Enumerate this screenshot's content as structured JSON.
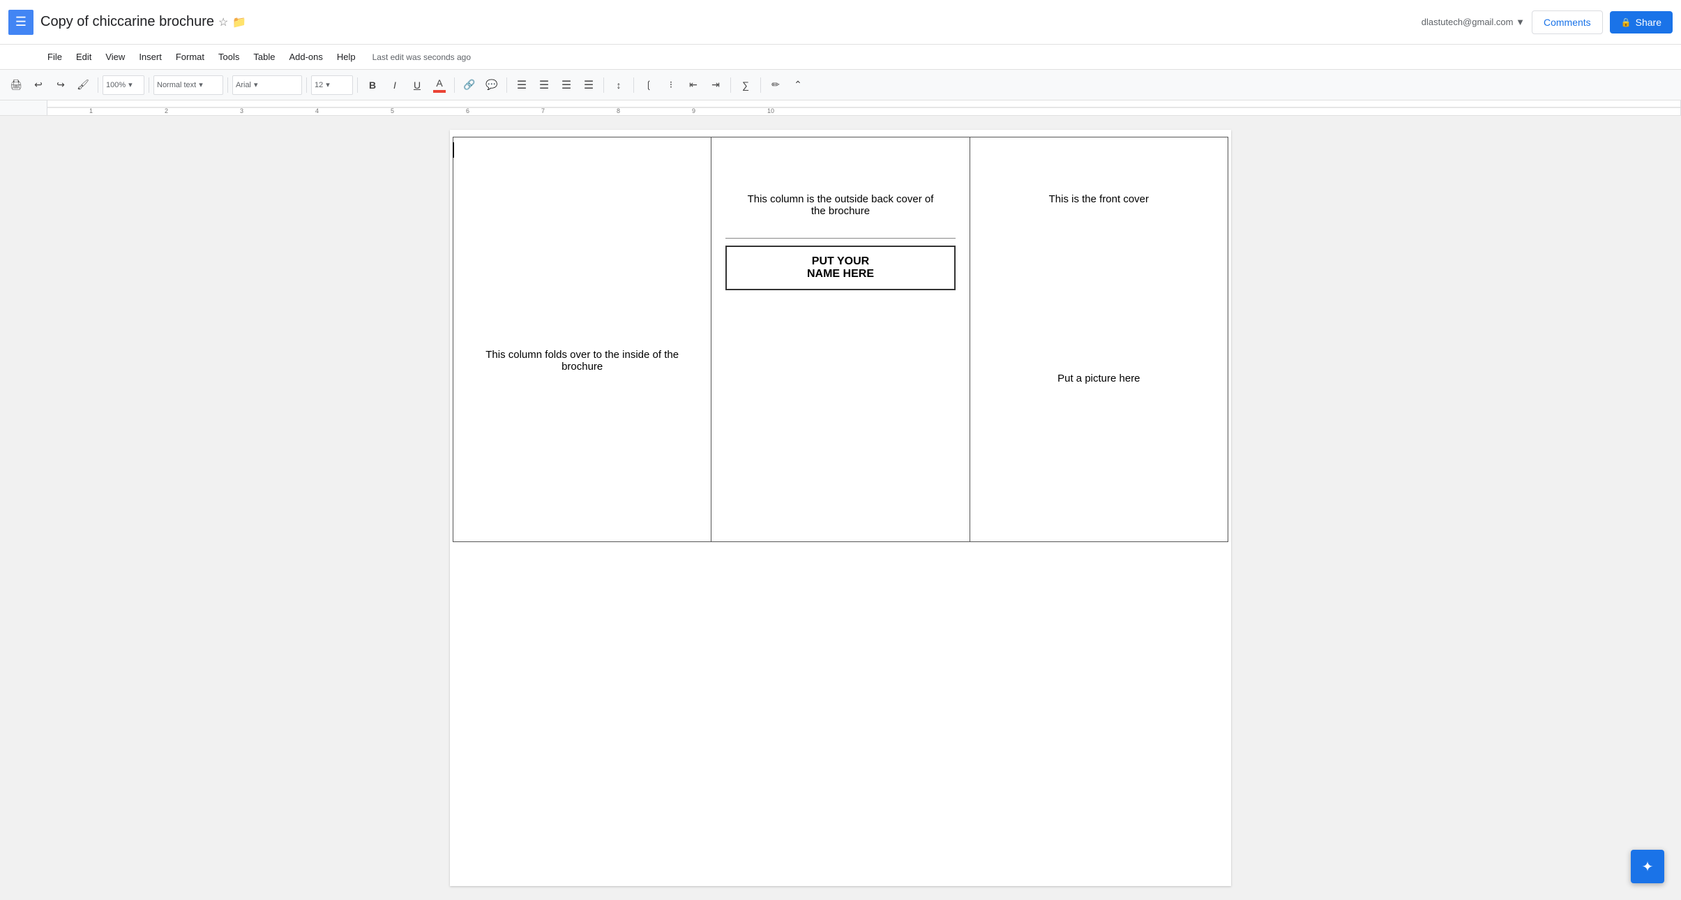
{
  "app": {
    "grid_icon": "☰",
    "title": "Copy of chiccarine brochure",
    "star_label": "☆",
    "folder_label": "📁"
  },
  "topright": {
    "user_email": "dlastutech@gmail.com",
    "dropdown_icon": "▼",
    "comments_label": "Comments",
    "share_label": "Share",
    "lock_icon": "🔒"
  },
  "menu": {
    "items": [
      "File",
      "Edit",
      "View",
      "Insert",
      "Format",
      "Tools",
      "Table",
      "Add-ons",
      "Help"
    ],
    "last_edit": "Last edit was seconds ago"
  },
  "toolbar": {
    "print_icon": "🖨",
    "undo_icon": "↩",
    "redo_icon": "↪",
    "paint_icon": "🖌",
    "zoom_value": "100%",
    "zoom_arrow": "▾",
    "style_value": "Normal text",
    "style_arrow": "▾",
    "font_value": "Arial",
    "font_arrow": "▾",
    "size_value": "12",
    "size_arrow": "▾",
    "bold_label": "B",
    "italic_label": "I",
    "underline_label": "U",
    "font_color_label": "A",
    "link_icon": "🔗",
    "comment_icon": "💬",
    "align_left": "≡",
    "align_center": "≡",
    "align_right": "≡",
    "align_justify": "≡",
    "line_spacing": "↕",
    "list_ordered": "≔",
    "list_unordered": "≔",
    "indent_dec": "⇤",
    "indent_inc": "⇥",
    "formula": "∑",
    "pen_icon": "✏",
    "collapse_icon": "⌃"
  },
  "document": {
    "col1_text": "This column folds over to the inside of the brochure",
    "col2_top_text": "This column is the outside back cover of the brochure",
    "col2_name_line1": "PUT YOUR",
    "col2_name_line2": "NAME HERE",
    "col3_top_text": "This is the front cover",
    "col3_picture_text": "Put a picture here"
  },
  "floating": {
    "icon": "✦"
  }
}
